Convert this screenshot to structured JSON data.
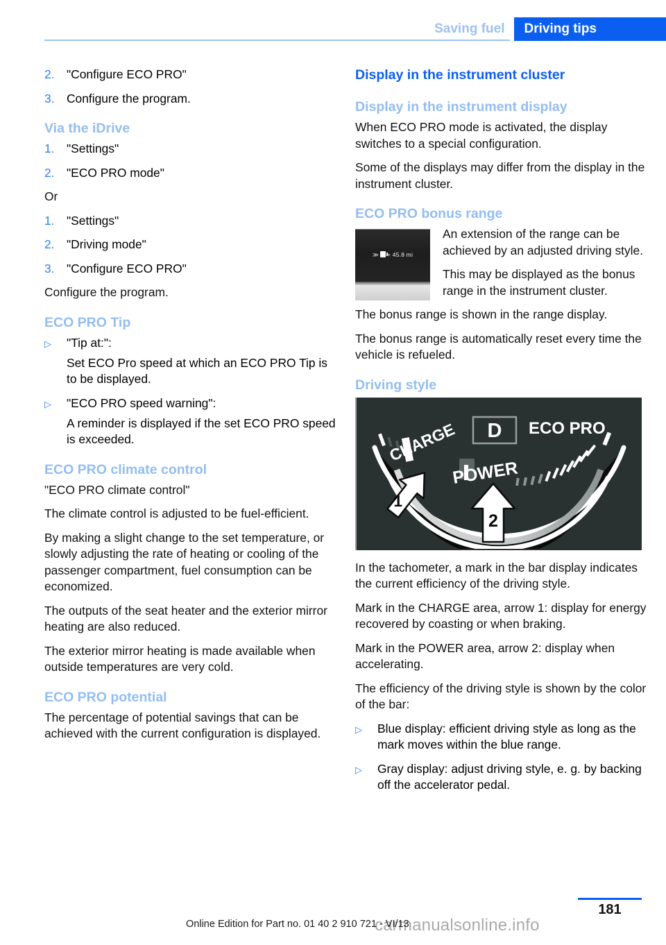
{
  "header": {
    "tab_inactive": "Saving fuel",
    "tab_active": "Driving tips",
    "accent_color": "#0a5ff0",
    "muted_color": "#9dc1f2"
  },
  "left_column": {
    "steps_top": [
      {
        "num": "2.",
        "text": "\"Configure ECO PRO\""
      },
      {
        "num": "3.",
        "text": "Configure the program."
      }
    ],
    "heading_idrive": "Via the iDrive",
    "steps_idrive": [
      {
        "num": "1.",
        "text": "\"Settings\""
      },
      {
        "num": "2.",
        "text": "\"ECO PRO mode\""
      }
    ],
    "or_text": "Or",
    "steps_idrive_alt": [
      {
        "num": "1.",
        "text": "\"Settings\""
      },
      {
        "num": "2.",
        "text": "\"Driving mode\""
      },
      {
        "num": "3.",
        "text": "\"Configure ECO PRO\""
      }
    ],
    "configure_note": "Configure the program.",
    "heading_tip": "ECO PRO Tip",
    "tip_bullets": [
      {
        "label": "\"Tip at:\":",
        "detail": "Set ECO Pro speed at which an ECO PRO Tip is to be displayed."
      },
      {
        "label": "\"ECO PRO speed warning\":",
        "detail": "A reminder is displayed if the set ECO PRO speed is exceeded."
      }
    ],
    "heading_climate": "ECO PRO climate control",
    "climate_paragraphs": [
      "\"ECO PRO climate control\"",
      "The climate control is adjusted to be fuel-efficient.",
      "By making a slight change to the set temperature, or slowly adjusting the rate of heating or cooling of the passenger compartment, fuel consumption can be economized.",
      "The outputs of the seat heater and the exterior mirror heating are also reduced.",
      "The exterior mirror heating is made available when outside temperatures are very cold."
    ],
    "heading_potential": "ECO PRO potential",
    "potential_paragraph": "The percentage of potential savings that can be achieved with the current configuration is displayed."
  },
  "right_column": {
    "heading_main": "Display in the instrument cluster",
    "heading_display": "Display in the instrument display",
    "display_paragraphs": [
      "When ECO PRO mode is activated, the display switches to a special configuration.",
      "Some of the displays may differ from the display in the instrument cluster."
    ],
    "heading_bonus": "ECO PRO bonus range",
    "instrument_display": {
      "chevron": "≫",
      "icon_name": "fuel-pump-icon",
      "value": "+ 45.8 mi"
    },
    "bonus_paragraphs": [
      "An extension of the range can be achieved by an adjusted driving style.",
      "This may be displayed as the bonus range in the instrument cluster.",
      "The bonus range is shown in the range display.",
      "The bonus range is automatically reset every time the vehicle is refueled."
    ],
    "heading_driving_style": "Driving style",
    "tachometer": {
      "gear_indicator": "D",
      "mode_label": "ECO PRO",
      "charge_label": "CHARGE",
      "power_label": "POWER",
      "arrow_1": "1",
      "arrow_2": "2"
    },
    "driving_style_paragraphs": [
      "In the tachometer, a mark in the bar display indicates the current efficiency of the driving style.",
      "Mark in the CHARGE area, arrow 1: display for energy recovered by coasting or when braking.",
      "Mark in the POWER area, arrow 2: display when accelerating.",
      "The efficiency of the driving style is shown by the color of the bar:"
    ],
    "color_bullets": [
      "Blue display: efficient driving style as long as the mark moves within the blue range.",
      "Gray display: adjust driving style, e. g. by backing off the accelerator pedal."
    ]
  },
  "footer": {
    "page_number": "181",
    "edition": "Online Edition for Part no. 01 40 2 910 721 - VI/13",
    "watermark": "carmanualsonline.info"
  }
}
